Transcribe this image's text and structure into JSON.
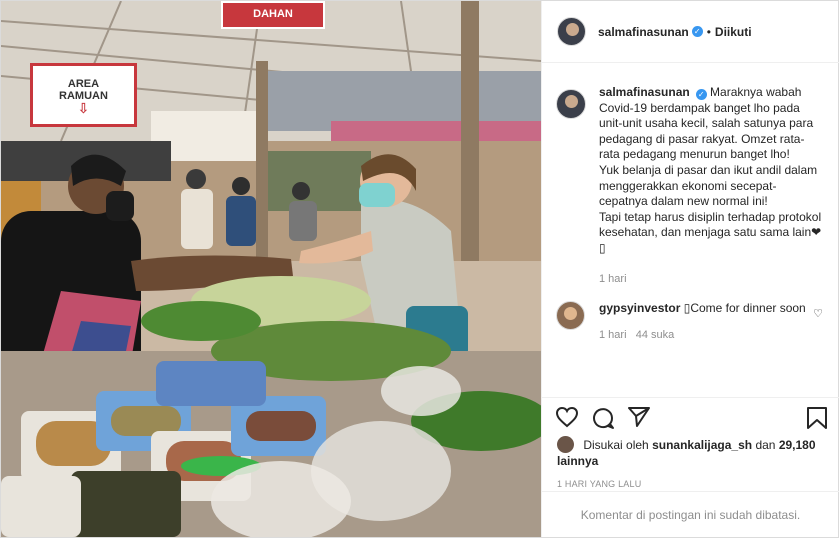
{
  "post": {
    "username": "salmafinasunan",
    "verified": true,
    "separator": "•",
    "follow_label": "Diikuti"
  },
  "photo": {
    "sign_line1": "AREA",
    "sign_line2": "RAMUAN",
    "sign_arrow": "⇩",
    "top_sign_text": "DAHAN"
  },
  "caption": {
    "username": "salmafinasunan",
    "paragraphs": [
      "Maraknya wabah Covid-19 berdampak banget lho pada unit-unit usaha kecil, salah satunya para pedagang di pasar rakyat. Omzet rata-rata pedagang menurun banget lho!",
      "Yuk belanja di pasar dan ikut andil dalam menggerakkan ekonomi secepat-cepatnya dalam new normal ini!",
      "Tapi tetap harus disiplin terhadap protokol kesehatan, dan menjaga satu sama lain❤ ▯"
    ],
    "time": "1 hari"
  },
  "comment": {
    "username": "gypsyinvestor",
    "text": "▯Come for dinner soon",
    "time": "1 hari",
    "likes_text": "44 suka",
    "like_icon": "heart-outline-icon"
  },
  "actions": {
    "icons": [
      "heart-icon",
      "comment-icon",
      "share-icon",
      "bookmark-icon"
    ],
    "liked_by_prefix": "Disukai oleh",
    "liked_by_user": "sunankalijaga_sh",
    "liked_by_and": "dan",
    "others_count": "29,180",
    "others_label": "lainnya",
    "posted_date": "1 HARI YANG LALU",
    "comments_disabled": "Komentar di postingan ini sudah dibatasi."
  },
  "colors": {
    "verified_blue": "#3897f0",
    "text_primary": "#262626",
    "text_muted": "#8e8e8e",
    "border": "#dbdbdb",
    "sign_red": "#c7373d"
  }
}
